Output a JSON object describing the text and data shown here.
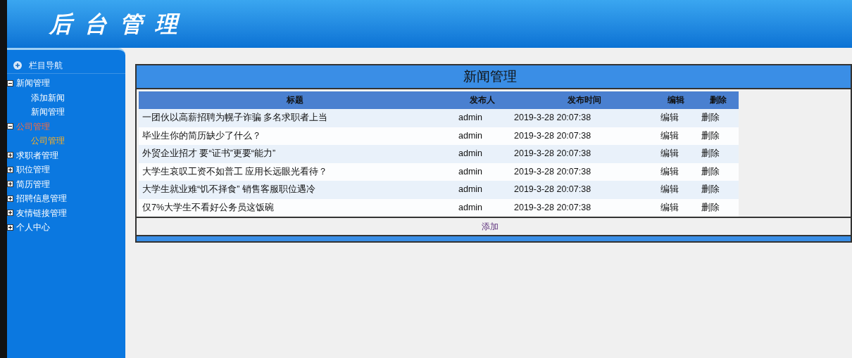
{
  "header": {
    "title": "后台管理"
  },
  "sidebar": {
    "title": "栏目导航",
    "items": [
      {
        "label": "新闻管理",
        "expanded": true,
        "selected": false,
        "children": [
          {
            "label": "添加新闻",
            "selected": false
          },
          {
            "label": "新闻管理",
            "selected": false
          }
        ]
      },
      {
        "label": "公司管理",
        "expanded": true,
        "selected": true,
        "children": [
          {
            "label": "公司管理",
            "selected": true
          }
        ]
      },
      {
        "label": "求职者管理",
        "expanded": false,
        "selected": false
      },
      {
        "label": "职位管理",
        "expanded": false,
        "selected": false
      },
      {
        "label": "简历管理",
        "expanded": false,
        "selected": false
      },
      {
        "label": "招聘信息管理",
        "expanded": false,
        "selected": false
      },
      {
        "label": "友情链接管理",
        "expanded": false,
        "selected": false
      },
      {
        "label": "个人中心",
        "expanded": false,
        "selected": false
      }
    ]
  },
  "panel": {
    "title": "新闻管理",
    "add_link": "添加"
  },
  "table": {
    "columns": [
      "标题",
      "发布人",
      "发布时间",
      "编辑",
      "删除"
    ],
    "rows": [
      [
        "一团伙以高薪招聘为幌子诈骗 多名求职者上当",
        "admin",
        "2019-3-28 20:07:38",
        "编辑",
        "删除"
      ],
      [
        "毕业生你的简历缺少了什么？",
        "admin",
        "2019-3-28 20:07:38",
        "编辑",
        "删除"
      ],
      [
        "外贸企业招才 要“证书”更要“能力”",
        "admin",
        "2019-3-28 20:07:38",
        "编辑",
        "删除"
      ],
      [
        "大学生哀叹工资不如普工 应用长远眼光看待？",
        "admin",
        "2019-3-28 20:07:38",
        "编辑",
        "删除"
      ],
      [
        "大学生就业难“饥不择食” 销售客服职位遇冷",
        "admin",
        "2019-3-28 20:07:38",
        "编辑",
        "删除"
      ],
      [
        "仅7%大学生不看好公务员这饭碗",
        "admin",
        "2019-3-28 20:07:38",
        "编辑",
        "删除"
      ]
    ]
  }
}
